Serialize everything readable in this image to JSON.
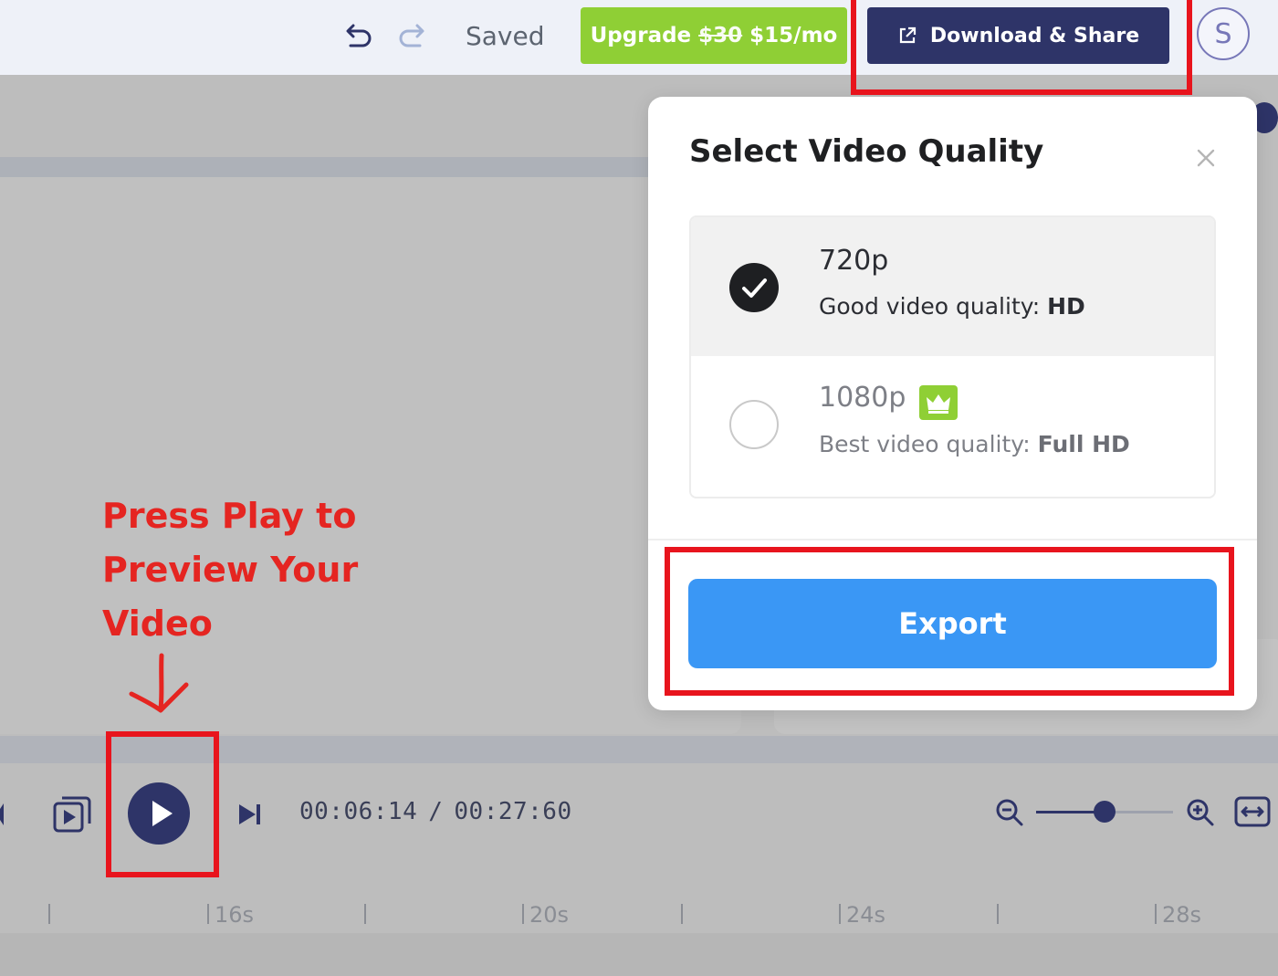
{
  "toolbar": {
    "saved_label": "Saved",
    "upgrade": {
      "prefix": "Upgrade",
      "old_price": "$30",
      "new_price": "$15/mo"
    },
    "download_label": "Download & Share",
    "avatar_initial": "S"
  },
  "annotation": {
    "lines": [
      "Press Play to",
      "Preview Your",
      "Video"
    ]
  },
  "modal": {
    "title": "Select Video Quality",
    "options": [
      {
        "title": "720p",
        "desc_prefix": "Good video quality: ",
        "desc_bold": "HD",
        "selected": true
      },
      {
        "title": "1080p",
        "desc_prefix": "Best video quality: ",
        "desc_bold": "Full HD",
        "selected": false,
        "badge_icon": "crown-icon"
      }
    ],
    "export_label": "Export"
  },
  "player": {
    "current_time": "00:06:14",
    "separator": "/",
    "total_time": "00:27:60",
    "zoom_level": 0.5
  },
  "timeline": {
    "labels": [
      "16s",
      "20s",
      "24s",
      "28s"
    ]
  },
  "colors": {
    "accent_navy": "#2e3468",
    "upgrade_green": "#8fcf35",
    "export_blue": "#3a97f5",
    "annotation_red": "#e8141d"
  }
}
